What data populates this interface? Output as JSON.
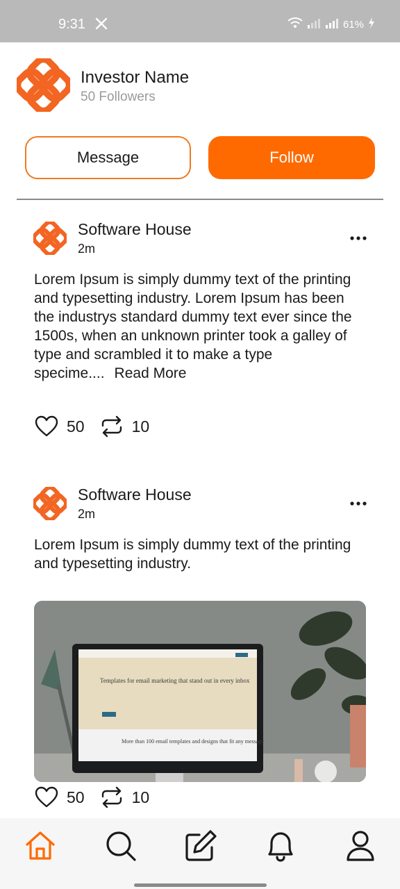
{
  "status_bar": {
    "time": "9:31",
    "battery": "61%"
  },
  "profile": {
    "name": "Investor Name",
    "followers": "50 Followers"
  },
  "actions": {
    "message_label": "Message",
    "follow_label": "Follow"
  },
  "posts": [
    {
      "author": "Software House",
      "time": "2m",
      "body": "Lorem Ipsum is simply dummy text of the printing and typesetting industry. Lorem Ipsum has been the industrys standard dummy text ever since the 1500s, when an unknown printer took a galley of type and scrambled it to make a type specime....",
      "read_more": "Read More",
      "likes": "50",
      "reposts": "10"
    },
    {
      "author": "Software House",
      "time": "2m",
      "body": "Lorem Ipsum is simply dummy text of the printing and typesetting industry.",
      "likes": "50",
      "reposts": "10",
      "image": {
        "headline": "Templates for email marketing that stand out in every inbox",
        "footer": "More than 100 email templates and designs that fit any message"
      }
    }
  ],
  "colors": {
    "accent": "#ff6a00",
    "status_bar": "#b9b9b9"
  },
  "nav": [
    "home-icon",
    "search-icon",
    "compose-icon",
    "bell-icon",
    "profile-icon"
  ]
}
